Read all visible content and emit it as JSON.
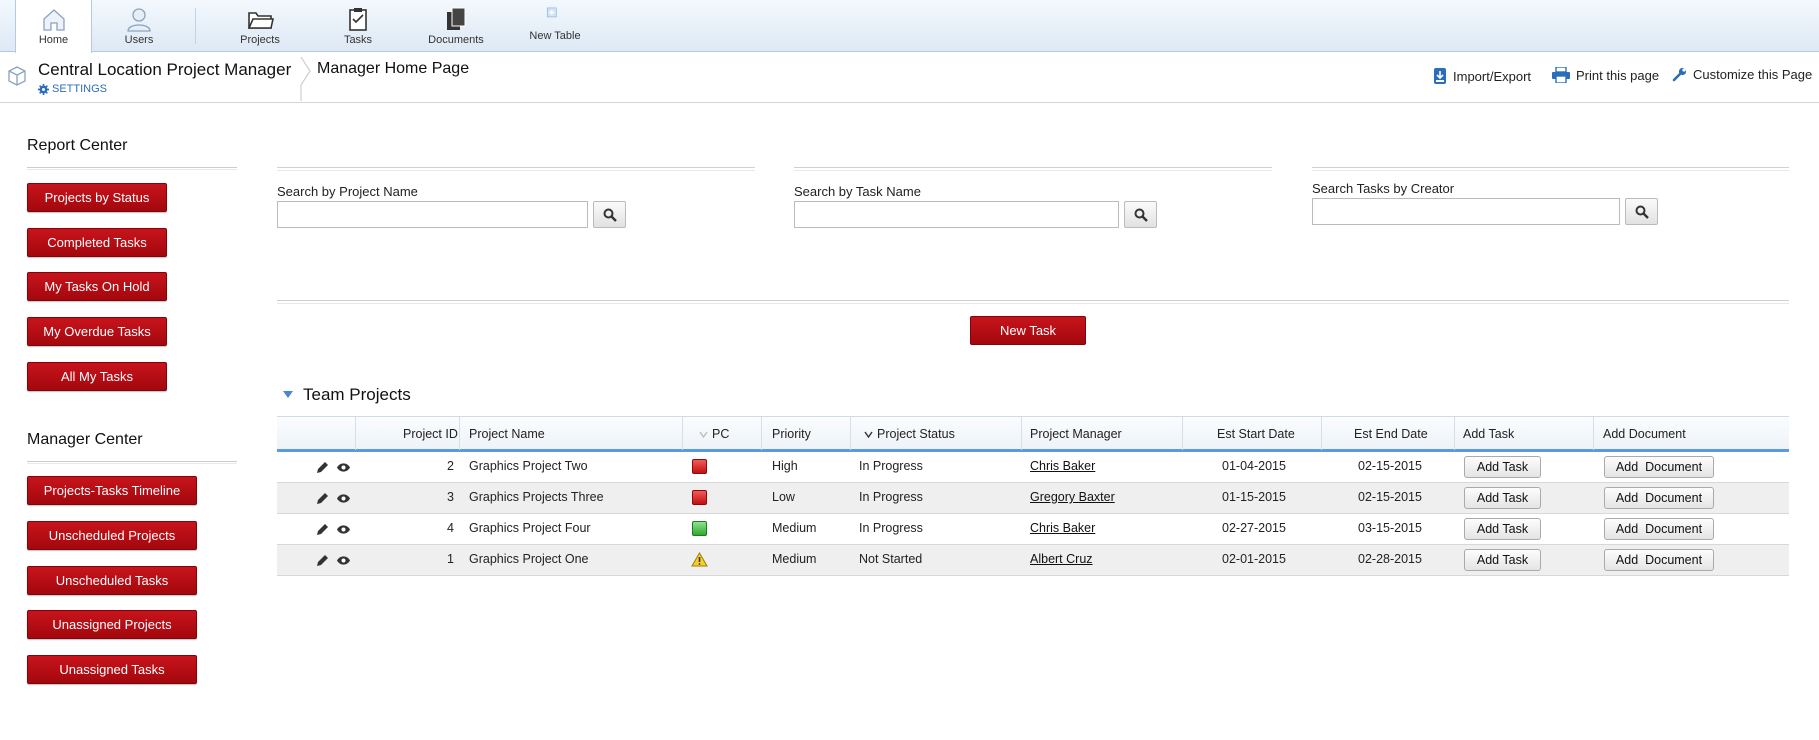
{
  "nav": {
    "items": [
      {
        "label": "Home",
        "icon": "home-icon",
        "active": true
      },
      {
        "label": "Users",
        "icon": "users-icon"
      },
      {
        "label": "Projects",
        "icon": "folder-icon"
      },
      {
        "label": "Tasks",
        "icon": "clipboard-icon"
      },
      {
        "label": "Documents",
        "icon": "documents-icon"
      },
      {
        "label": "New Table",
        "icon": "plus-icon"
      }
    ]
  },
  "header": {
    "app_title": "Central Location Project Manager",
    "settings_label": "SETTINGS",
    "page_title": "Manager Home Page",
    "actions": {
      "import_export": "Import/Export",
      "print": "Print this page",
      "customize": "Customize this Page"
    }
  },
  "report_center": {
    "title": "Report Center",
    "buttons": [
      "Projects by Status",
      "Completed Tasks",
      "My Tasks On Hold",
      "My Overdue Tasks",
      "All My Tasks"
    ]
  },
  "manager_center": {
    "title": "Manager Center",
    "buttons": [
      "Projects-Tasks Timeline",
      "Unscheduled Projects",
      "Unscheduled Tasks",
      "Unassigned Projects",
      "Unassigned Tasks"
    ]
  },
  "search": {
    "project": {
      "label": "Search by Project Name",
      "value": ""
    },
    "task": {
      "label": "Search by Task Name",
      "value": ""
    },
    "creator": {
      "label": "Search Tasks by Creator",
      "value": ""
    }
  },
  "new_task_label": "New Task",
  "team_projects": {
    "title": "Team Projects",
    "columns": [
      "Project ID",
      "Project Name",
      "PC",
      "Priority",
      "Project Status",
      "Project Manager",
      "Est Start Date",
      "Est End Date",
      "Add Task",
      "Add Document"
    ],
    "add_task_label": "Add Task",
    "add_document_label": "Add  Document",
    "rows": [
      {
        "id": "2",
        "name": "Graphics Project Two",
        "pc": "red",
        "priority": "High",
        "status": "In Progress",
        "manager": "Chris Baker",
        "start": "01-04-2015",
        "end": "02-15-2015"
      },
      {
        "id": "3",
        "name": "Graphics Projects Three",
        "pc": "red",
        "priority": "Low",
        "status": "In Progress",
        "manager": "Gregory Baxter",
        "start": "01-15-2015",
        "end": "02-15-2015"
      },
      {
        "id": "4",
        "name": "Graphics Project Four",
        "pc": "green",
        "priority": "Medium",
        "status": "In Progress",
        "manager": "Chris Baker",
        "start": "02-27-2015",
        "end": "03-15-2015"
      },
      {
        "id": "1",
        "name": "Graphics Project One",
        "pc": "warning",
        "priority": "Medium",
        "status": "Not Started",
        "manager": "Albert Cruz",
        "start": "02-01-2015",
        "end": "02-28-2015"
      }
    ]
  },
  "colors": {
    "primary_red": "#b30d14",
    "accent_blue": "#5a9be0",
    "link_blue": "#2a6ebb"
  }
}
